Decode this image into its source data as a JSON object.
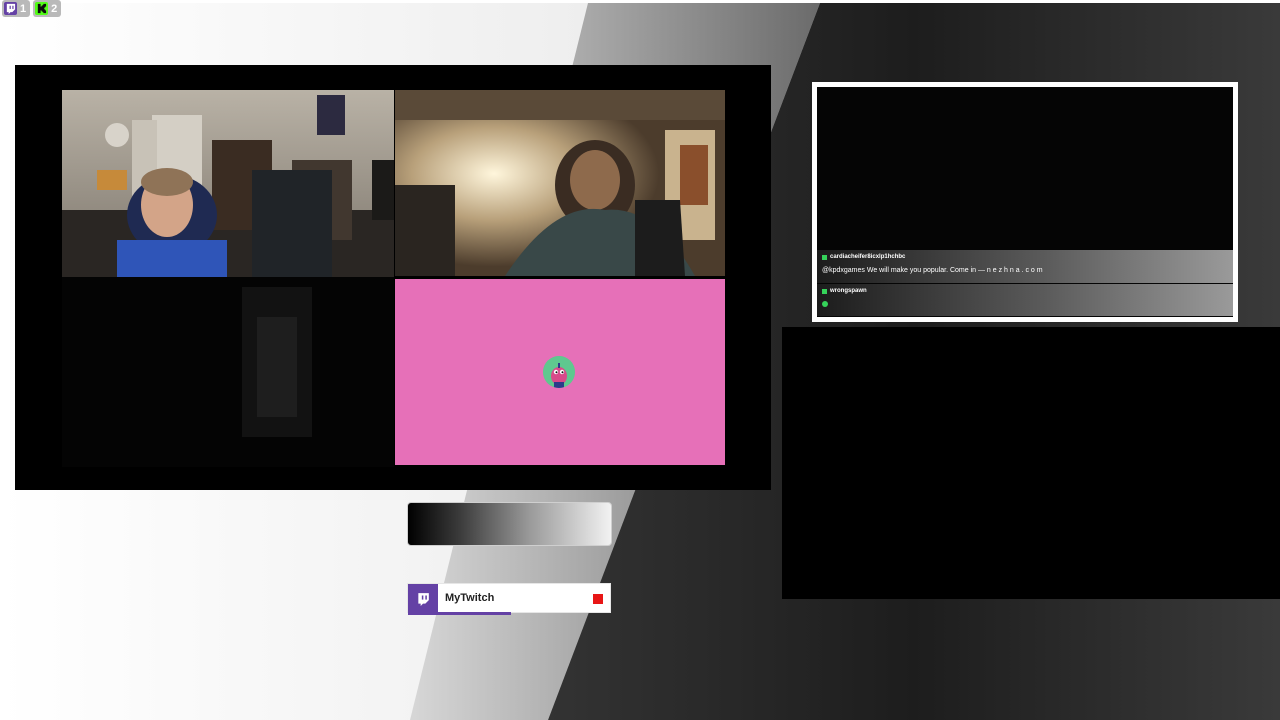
{
  "viewer_badges": [
    {
      "platform": "twitch",
      "count": "1",
      "color": "#6441a5"
    },
    {
      "platform": "kick",
      "count": "2",
      "color": "#53fc18"
    }
  ],
  "cameras": [
    {
      "id": "cam-1",
      "description": "streamer-room-webcam"
    },
    {
      "id": "cam-2",
      "description": "guest-webcam"
    },
    {
      "id": "cam-3",
      "description": "avatar-placeholder",
      "background": "#e670b8"
    }
  ],
  "chat": {
    "messages": [
      {
        "user": "cardiacheifer8icxlp1hchbc",
        "text": "@kpdxgames We will make you popular. Come in — n e z h n a . c o m"
      },
      {
        "user": "wrongspawn",
        "text": ""
      }
    ]
  },
  "stream_label": {
    "name": "MyTwitch",
    "icon": "twitch-icon",
    "status_color": "#e81616",
    "progress": 0.51
  }
}
